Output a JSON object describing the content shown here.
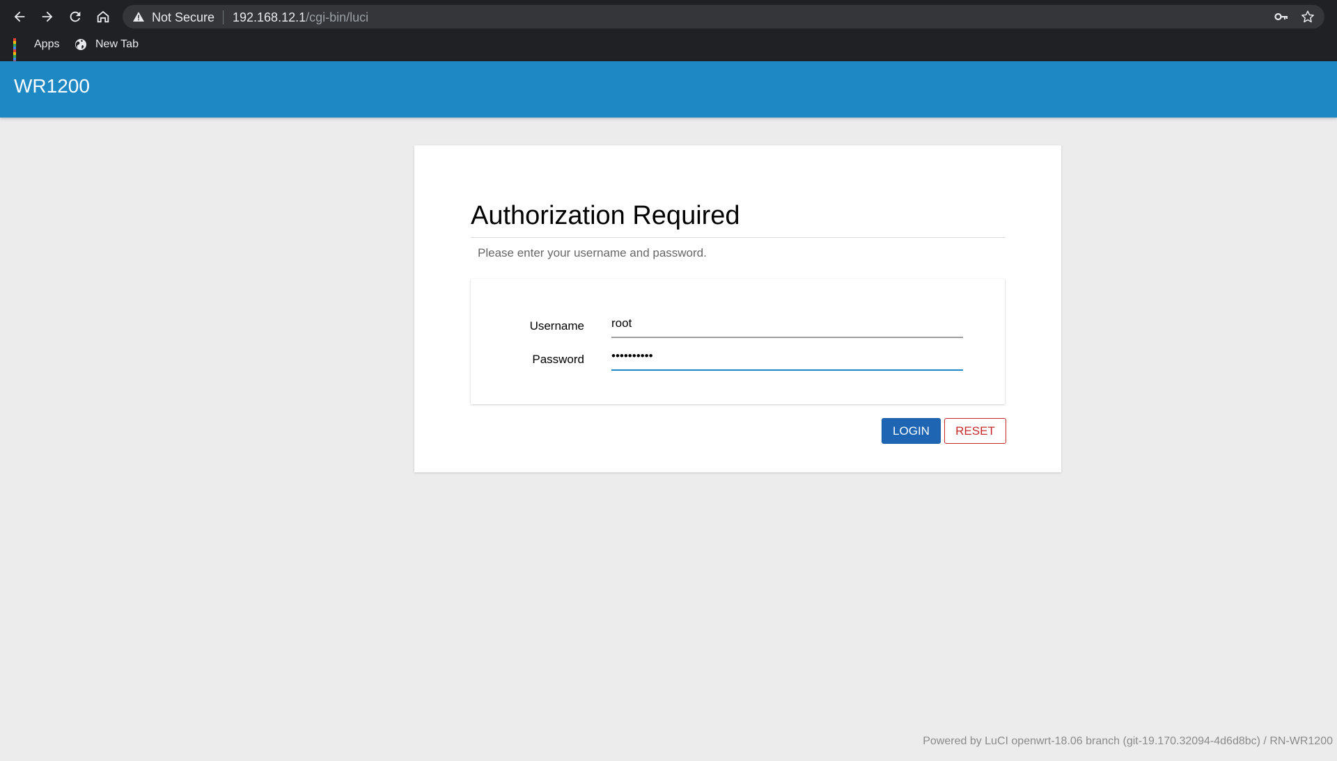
{
  "browser": {
    "security_status": "Not Secure",
    "url_host": "192.168.12.1",
    "url_path": "/cgi-bin/luci",
    "bookmarks": [
      {
        "label": "Apps",
        "icon": "apps-grid-icon"
      },
      {
        "label": "New Tab",
        "icon": "globe-icon"
      }
    ]
  },
  "header": {
    "brand": "WR1200",
    "color": "#1e88c4"
  },
  "login": {
    "title": "Authorization Required",
    "description": "Please enter your username and password.",
    "username_label": "Username",
    "username_value": "root",
    "password_label": "Password",
    "password_value": "password12",
    "login_button": "LOGIN",
    "reset_button": "RESET"
  },
  "footer": {
    "text": "Powered by LuCI openwrt-18.06 branch (git-19.170.32094-4d6d8bc) / RN-WR1200"
  },
  "colors": {
    "accent": "#1e88c4",
    "login_button": "#1e66b4",
    "reset_button": "#c62828"
  }
}
